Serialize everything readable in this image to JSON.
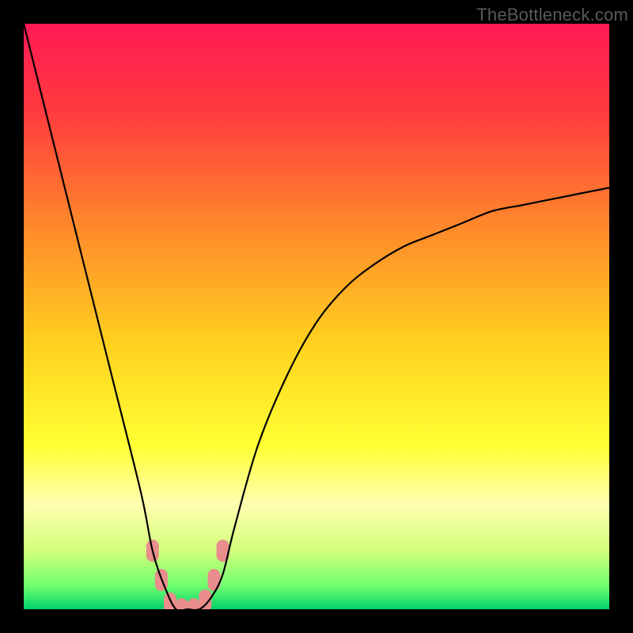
{
  "watermark": "TheBottleneck.com",
  "chart_data": {
    "type": "line",
    "title": "",
    "xlabel": "",
    "ylabel": "",
    "xlim": [
      0,
      100
    ],
    "ylim": [
      0,
      100
    ],
    "grid": false,
    "series": [
      {
        "name": "bottleneck-curve",
        "x": [
          0,
          5,
          10,
          15,
          20,
          22,
          24,
          26,
          28,
          30,
          32,
          34,
          36,
          40,
          45,
          50,
          55,
          60,
          65,
          70,
          75,
          80,
          85,
          90,
          95,
          100
        ],
        "y": [
          100,
          80,
          60,
          40,
          20,
          10,
          4,
          0,
          0,
          0,
          2,
          6,
          14,
          28,
          40,
          49,
          55,
          59,
          62,
          64,
          66,
          68,
          69,
          70,
          71,
          72
        ],
        "color": "#000000"
      }
    ],
    "highlight_points": {
      "name": "sweet-spot-markers",
      "color": "#e98d8d",
      "points": [
        {
          "x": 22,
          "y": 10
        },
        {
          "x": 23.5,
          "y": 5
        },
        {
          "x": 25,
          "y": 1
        },
        {
          "x": 27,
          "y": 0
        },
        {
          "x": 29,
          "y": 0
        },
        {
          "x": 31,
          "y": 1.5
        },
        {
          "x": 32.5,
          "y": 5
        },
        {
          "x": 34,
          "y": 10
        }
      ]
    },
    "background_gradient": {
      "type": "vertical",
      "stops": [
        {
          "pos": 0.0,
          "color": "#ff1a55"
        },
        {
          "pos": 0.15,
          "color": "#ff3b3e"
        },
        {
          "pos": 0.35,
          "color": "#ff8a2a"
        },
        {
          "pos": 0.55,
          "color": "#ffd21f"
        },
        {
          "pos": 0.72,
          "color": "#ffff33"
        },
        {
          "pos": 0.82,
          "color": "#ffffb0"
        },
        {
          "pos": 0.9,
          "color": "#d2ff7a"
        },
        {
          "pos": 0.96,
          "color": "#6fff6f"
        },
        {
          "pos": 1.0,
          "color": "#00d26a"
        }
      ]
    }
  }
}
